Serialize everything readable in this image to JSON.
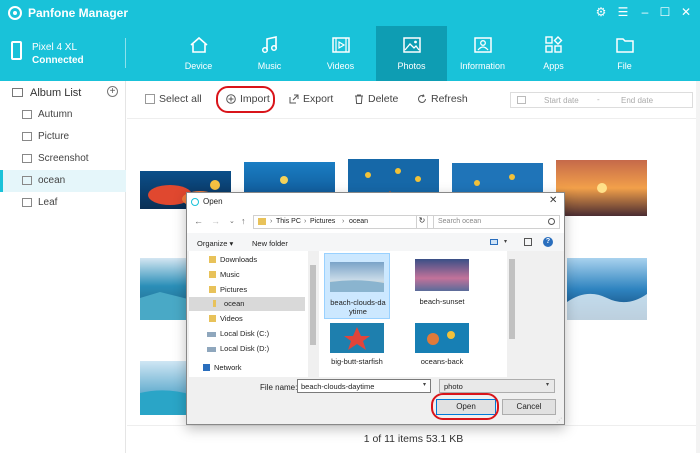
{
  "app": {
    "title": "Panfone Manager",
    "window_controls": [
      "gear-icon",
      "menu-icon",
      "minimize-icon",
      "maximize-icon",
      "close-icon"
    ]
  },
  "device": {
    "name": "Pixel 4 XL",
    "status": "Connected"
  },
  "nav_tabs": [
    {
      "label": "Device",
      "icon": "home-icon"
    },
    {
      "label": "Music",
      "icon": "music-note-icon"
    },
    {
      "label": "Videos",
      "icon": "film-icon"
    },
    {
      "label": "Photos",
      "icon": "image-icon",
      "active": true
    },
    {
      "label": "Information",
      "icon": "contact-card-icon"
    },
    {
      "label": "Apps",
      "icon": "apps-grid-icon"
    },
    {
      "label": "File",
      "icon": "folder-icon"
    }
  ],
  "sidebar": {
    "title": "Album List",
    "add_icon": "plus-circle-icon",
    "items": [
      {
        "label": "Autumn"
      },
      {
        "label": "Picture"
      },
      {
        "label": "Screenshot"
      },
      {
        "label": "ocean",
        "active": true
      },
      {
        "label": "Leaf"
      }
    ]
  },
  "toolbar": {
    "select_all": "Select all",
    "import": "Import",
    "export": "Export",
    "delete": "Delete",
    "refresh": "Refresh",
    "start_date_placeholder": "Start date",
    "date_separator": "-",
    "end_date_placeholder": "End date"
  },
  "gallery": {
    "status": "1 of 11 items 53.1 KB"
  },
  "dialog": {
    "title": "Open",
    "close": "✕",
    "breadcrumbs": [
      "This PC",
      "Pictures",
      "ocean"
    ],
    "search_placeholder": "Search ocean",
    "organize": "Organize",
    "new_folder": "New folder",
    "nav_items": [
      {
        "label": "Downloads"
      },
      {
        "label": "Music"
      },
      {
        "label": "Pictures"
      },
      {
        "label": "ocean",
        "selected": true
      },
      {
        "label": "Videos"
      },
      {
        "label": "Local Disk (C:)"
      },
      {
        "label": "Local Disk (D:)"
      },
      {
        "label": "Network"
      }
    ],
    "files": [
      {
        "name": "beach-clouds-daytime",
        "selected": true
      },
      {
        "name": "beach-sunset"
      },
      {
        "name": "big-butt-starfish"
      },
      {
        "name": "oceans-back"
      }
    ],
    "file_name_label": "File name:",
    "file_name_value": "beach-clouds-daytime",
    "file_type": "photo",
    "open_button": "Open",
    "cancel_button": "Cancel"
  },
  "colors": {
    "brand": "#19c2d9",
    "highlight": "#d9141a",
    "active_tab": "#0e9db3"
  }
}
